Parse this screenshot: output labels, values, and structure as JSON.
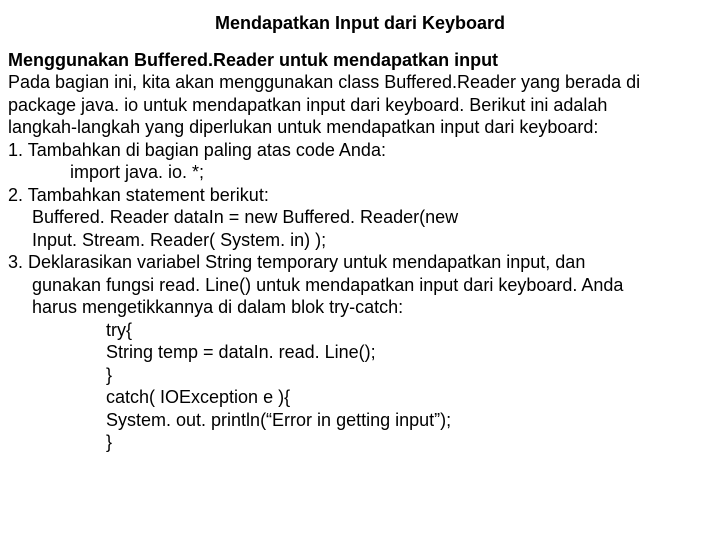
{
  "title": "Mendapatkan Input dari Keyboard",
  "subtitle": "Menggunakan Buffered.Reader untuk mendapatkan input",
  "p1": "Pada bagian ini, kita akan menggunakan class Buffered.Reader yang berada di",
  "p2": "package java. io untuk mendapatkan input dari keyboard. Berikut ini adalah",
  "p3": "langkah-langkah yang diperlukan untuk mendapatkan input dari keyboard:",
  "l1": "1. Tambahkan di bagian paling atas code Anda:",
  "l1a": "import java. io. *;",
  "l2": "2. Tambahkan statement berikut:",
  "l2a": "Buffered. Reader dataIn = new Buffered. Reader(new",
  "l2b": "Input. Stream. Reader( System. in) );",
  "l3": "3. Deklarasikan variabel String temporary untuk mendapatkan input, dan",
  "l3a": "gunakan fungsi read. Line() untuk mendapatkan input dari keyboard. Anda",
  "l3b": "harus mengetikkannya di dalam blok try-catch:",
  "c1": "try{",
  "c2": "String temp = dataIn. read. Line();",
  "c3": "}",
  "c4": "catch( IOException e ){",
  "c5": "System. out. println(“Error in getting input”);",
  "c6": "}"
}
